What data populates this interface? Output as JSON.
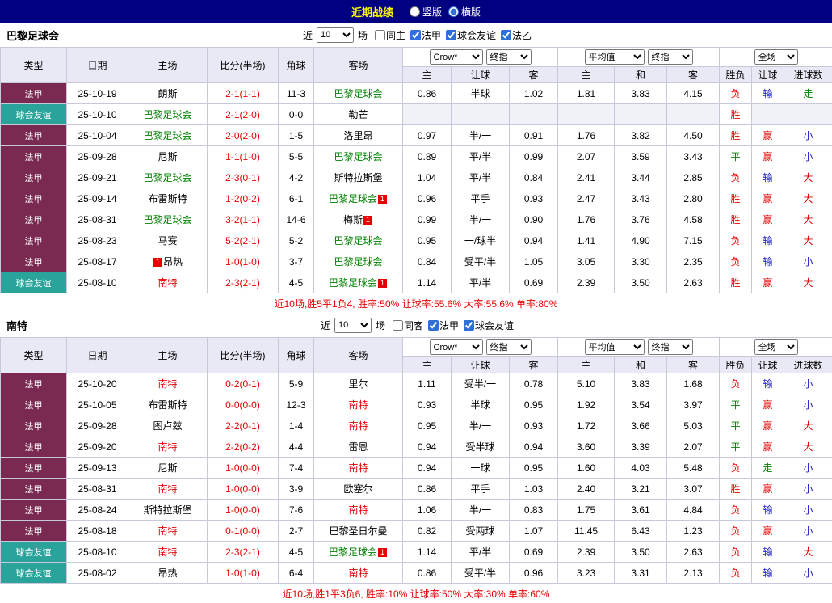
{
  "topbar": {
    "title": "近期战绩",
    "view_options": [
      {
        "label": "竖版",
        "selected": false
      },
      {
        "label": "横版",
        "selected": true
      }
    ]
  },
  "colors": {
    "topbar_bg": "#000080",
    "topbar_title": "#FFFF00",
    "ligue1_bg": "#7A2950",
    "friendly_bg": "#2AA39B",
    "header_bg": "#E9E9F5",
    "grid_border": "#C8C8DC",
    "score_text": "#E60000",
    "win_text": "#E60000",
    "draw_text": "#008000",
    "lose_text": "#2222CC",
    "team_paris": "#008000",
    "team_nantes": "#E60000"
  },
  "table_headers": {
    "left": [
      "类型",
      "日期",
      "主场",
      "比分(半场)",
      "角球",
      "客场"
    ],
    "odds": [
      "主",
      "让球",
      "客"
    ],
    "avg": [
      "主",
      "和",
      "客"
    ],
    "result": [
      "胜负",
      "让球",
      "进球数"
    ]
  },
  "selects": {
    "bookmaker": "Crow*",
    "stage": "终指",
    "average": "平均值",
    "stage2": "终指",
    "scope": "全场"
  },
  "tables": [
    {
      "team": "巴黎足球会",
      "filter": {
        "near_label": "近",
        "count": "10",
        "unit_label": "场",
        "checkboxes": [
          {
            "label": "同主",
            "checked": false
          },
          {
            "label": "法甲",
            "checked": true
          },
          {
            "label": "球会友谊",
            "checked": true
          },
          {
            "label": "法乙",
            "checked": true
          }
        ]
      },
      "rows": [
        {
          "league": "法甲",
          "date": "25-10-19",
          "home": {
            "name": "朗斯"
          },
          "score": "2-1(1-1)",
          "corners": "11-3",
          "away": {
            "name": "巴黎足球会",
            "color": "green"
          },
          "odds": [
            "0.86",
            "半球",
            "1.02"
          ],
          "avg": [
            "1.81",
            "3.83",
            "4.15"
          ],
          "results": [
            [
              "负",
              "red"
            ],
            [
              "输",
              "blue"
            ],
            [
              "走",
              "green"
            ]
          ]
        },
        {
          "league": "球会友谊",
          "date": "25-10-10",
          "home": {
            "name": "巴黎足球会",
            "color": "green"
          },
          "score": "2-1(2-0)",
          "corners": "0-0",
          "away": {
            "name": "勒芒"
          },
          "odds": null,
          "avg": null,
          "results": [
            [
              "胜",
              "red"
            ],
            null,
            null
          ]
        },
        {
          "league": "法甲",
          "date": "25-10-04",
          "home": {
            "name": "巴黎足球会",
            "color": "green"
          },
          "score": "2-0(2-0)",
          "corners": "1-5",
          "away": {
            "name": "洛里昂"
          },
          "odds": [
            "0.97",
            "半/一",
            "0.91"
          ],
          "avg": [
            "1.76",
            "3.82",
            "4.50"
          ],
          "results": [
            [
              "胜",
              "red"
            ],
            [
              "赢",
              "red"
            ],
            [
              "小",
              "blue"
            ]
          ]
        },
        {
          "league": "法甲",
          "date": "25-09-28",
          "home": {
            "name": "尼斯"
          },
          "score": "1-1(1-0)",
          "corners": "5-5",
          "away": {
            "name": "巴黎足球会",
            "color": "green"
          },
          "odds": [
            "0.89",
            "平/半",
            "0.99"
          ],
          "avg": [
            "2.07",
            "3.59",
            "3.43"
          ],
          "results": [
            [
              "平",
              "green"
            ],
            [
              "赢",
              "red"
            ],
            [
              "小",
              "blue"
            ]
          ]
        },
        {
          "league": "法甲",
          "date": "25-09-21",
          "home": {
            "name": "巴黎足球会",
            "color": "green"
          },
          "score": "2-3(0-1)",
          "corners": "4-2",
          "away": {
            "name": "斯特拉斯堡"
          },
          "odds": [
            "1.04",
            "平/半",
            "0.84"
          ],
          "avg": [
            "2.41",
            "3.44",
            "2.85"
          ],
          "results": [
            [
              "负",
              "red"
            ],
            [
              "输",
              "blue"
            ],
            [
              "大",
              "red"
            ]
          ]
        },
        {
          "league": "法甲",
          "date": "25-09-14",
          "home": {
            "name": "布雷斯特"
          },
          "score": "1-2(0-2)",
          "corners": "6-1",
          "away": {
            "name": "巴黎足球会",
            "color": "green",
            "badge": "1",
            "badge_pos": "after"
          },
          "odds": [
            "0.96",
            "平手",
            "0.93"
          ],
          "avg": [
            "2.47",
            "3.43",
            "2.80"
          ],
          "results": [
            [
              "胜",
              "red"
            ],
            [
              "赢",
              "red"
            ],
            [
              "大",
              "red"
            ]
          ]
        },
        {
          "league": "法甲",
          "date": "25-08-31",
          "home": {
            "name": "巴黎足球会",
            "color": "green"
          },
          "score": "3-2(1-1)",
          "corners": "14-6",
          "away": {
            "name": "梅斯",
            "badge": "1",
            "badge_pos": "after"
          },
          "odds": [
            "0.99",
            "半/一",
            "0.90"
          ],
          "avg": [
            "1.76",
            "3.76",
            "4.58"
          ],
          "results": [
            [
              "胜",
              "red"
            ],
            [
              "赢",
              "red"
            ],
            [
              "大",
              "red"
            ]
          ]
        },
        {
          "league": "法甲",
          "date": "25-08-23",
          "home": {
            "name": "马赛"
          },
          "score": "5-2(2-1)",
          "corners": "5-2",
          "away": {
            "name": "巴黎足球会",
            "color": "green"
          },
          "odds": [
            "0.95",
            "一/球半",
            "0.94"
          ],
          "avg": [
            "1.41",
            "4.90",
            "7.15"
          ],
          "results": [
            [
              "负",
              "red"
            ],
            [
              "输",
              "blue"
            ],
            [
              "大",
              "red"
            ]
          ]
        },
        {
          "league": "法甲",
          "date": "25-08-17",
          "home": {
            "name": "昂热",
            "badge": "1",
            "badge_pos": "before"
          },
          "score": "1-0(1-0)",
          "corners": "3-7",
          "away": {
            "name": "巴黎足球会",
            "color": "green"
          },
          "odds": [
            "0.84",
            "受平/半",
            "1.05"
          ],
          "avg": [
            "3.05",
            "3.30",
            "2.35"
          ],
          "results": [
            [
              "负",
              "red"
            ],
            [
              "输",
              "blue"
            ],
            [
              "小",
              "blue"
            ]
          ]
        },
        {
          "league": "球会友谊",
          "date": "25-08-10",
          "home": {
            "name": "南特",
            "color": "red"
          },
          "score": "2-3(2-1)",
          "corners": "4-5",
          "away": {
            "name": "巴黎足球会",
            "color": "green",
            "badge": "1",
            "badge_pos": "after"
          },
          "odds": [
            "1.14",
            "平/半",
            "0.69"
          ],
          "avg": [
            "2.39",
            "3.50",
            "2.63"
          ],
          "results": [
            [
              "胜",
              "red"
            ],
            [
              "赢",
              "red"
            ],
            [
              "大",
              "red"
            ]
          ]
        }
      ],
      "summary": "近10场,胜5平1负4, 胜率:50% 让球率:55.6% 大率:55.6% 单率:80%"
    },
    {
      "team": "南特",
      "filter": {
        "near_label": "近",
        "count": "10",
        "unit_label": "场",
        "checkboxes": [
          {
            "label": "同客",
            "checked": false
          },
          {
            "label": "法甲",
            "checked": true
          },
          {
            "label": "球会友谊",
            "checked": true
          }
        ]
      },
      "rows": [
        {
          "league": "法甲",
          "date": "25-10-20",
          "home": {
            "name": "南特",
            "color": "red"
          },
          "score": "0-2(0-1)",
          "corners": "5-9",
          "away": {
            "name": "里尔"
          },
          "odds": [
            "1.11",
            "受半/一",
            "0.78"
          ],
          "avg": [
            "5.10",
            "3.83",
            "1.68"
          ],
          "results": [
            [
              "负",
              "red"
            ],
            [
              "输",
              "blue"
            ],
            [
              "小",
              "blue"
            ]
          ]
        },
        {
          "league": "法甲",
          "date": "25-10-05",
          "home": {
            "name": "布雷斯特"
          },
          "score": "0-0(0-0)",
          "corners": "12-3",
          "away": {
            "name": "南特",
            "color": "red"
          },
          "odds": [
            "0.93",
            "半球",
            "0.95"
          ],
          "avg": [
            "1.92",
            "3.54",
            "3.97"
          ],
          "results": [
            [
              "平",
              "green"
            ],
            [
              "赢",
              "red"
            ],
            [
              "小",
              "blue"
            ]
          ]
        },
        {
          "league": "法甲",
          "date": "25-09-28",
          "home": {
            "name": "图卢兹"
          },
          "score": "2-2(0-1)",
          "corners": "1-4",
          "away": {
            "name": "南特",
            "color": "red"
          },
          "odds": [
            "0.95",
            "半/一",
            "0.93"
          ],
          "avg": [
            "1.72",
            "3.66",
            "5.03"
          ],
          "results": [
            [
              "平",
              "green"
            ],
            [
              "赢",
              "red"
            ],
            [
              "大",
              "red"
            ]
          ]
        },
        {
          "league": "法甲",
          "date": "25-09-20",
          "home": {
            "name": "南特",
            "color": "red"
          },
          "score": "2-2(0-2)",
          "corners": "4-4",
          "away": {
            "name": "雷恩"
          },
          "odds": [
            "0.94",
            "受半球",
            "0.94"
          ],
          "avg": [
            "3.60",
            "3.39",
            "2.07"
          ],
          "results": [
            [
              "平",
              "green"
            ],
            [
              "赢",
              "red"
            ],
            [
              "大",
              "red"
            ]
          ]
        },
        {
          "league": "法甲",
          "date": "25-09-13",
          "home": {
            "name": "尼斯"
          },
          "score": "1-0(0-0)",
          "corners": "7-4",
          "away": {
            "name": "南特",
            "color": "red"
          },
          "odds": [
            "0.94",
            "一球",
            "0.95"
          ],
          "avg": [
            "1.60",
            "4.03",
            "5.48"
          ],
          "results": [
            [
              "负",
              "red"
            ],
            [
              "走",
              "green"
            ],
            [
              "小",
              "blue"
            ]
          ]
        },
        {
          "league": "法甲",
          "date": "25-08-31",
          "home": {
            "name": "南特",
            "color": "red"
          },
          "score": "1-0(0-0)",
          "corners": "3-9",
          "away": {
            "name": "欧塞尔"
          },
          "odds": [
            "0.86",
            "平手",
            "1.03"
          ],
          "avg": [
            "2.40",
            "3.21",
            "3.07"
          ],
          "results": [
            [
              "胜",
              "red"
            ],
            [
              "赢",
              "red"
            ],
            [
              "小",
              "blue"
            ]
          ]
        },
        {
          "league": "法甲",
          "date": "25-08-24",
          "home": {
            "name": "斯特拉斯堡"
          },
          "score": "1-0(0-0)",
          "corners": "7-6",
          "away": {
            "name": "南特",
            "color": "red"
          },
          "odds": [
            "1.06",
            "半/一",
            "0.83"
          ],
          "avg": [
            "1.75",
            "3.61",
            "4.84"
          ],
          "results": [
            [
              "负",
              "red"
            ],
            [
              "输",
              "blue"
            ],
            [
              "小",
              "blue"
            ]
          ]
        },
        {
          "league": "法甲",
          "date": "25-08-18",
          "home": {
            "name": "南特",
            "color": "red"
          },
          "score": "0-1(0-0)",
          "corners": "2-7",
          "away": {
            "name": "巴黎圣日尔曼"
          },
          "odds": [
            "0.82",
            "受两球",
            "1.07"
          ],
          "avg": [
            "11.45",
            "6.43",
            "1.23"
          ],
          "results": [
            [
              "负",
              "red"
            ],
            [
              "赢",
              "red"
            ],
            [
              "小",
              "blue"
            ]
          ]
        },
        {
          "league": "球会友谊",
          "date": "25-08-10",
          "home": {
            "name": "南特",
            "color": "red"
          },
          "score": "2-3(2-1)",
          "corners": "4-5",
          "away": {
            "name": "巴黎足球会",
            "color": "green",
            "badge": "1",
            "badge_pos": "after"
          },
          "odds": [
            "1.14",
            "平/半",
            "0.69"
          ],
          "avg": [
            "2.39",
            "3.50",
            "2.63"
          ],
          "results": [
            [
              "负",
              "red"
            ],
            [
              "输",
              "blue"
            ],
            [
              "大",
              "red"
            ]
          ]
        },
        {
          "league": "球会友谊",
          "date": "25-08-02",
          "home": {
            "name": "昂热"
          },
          "score": "1-0(1-0)",
          "corners": "6-4",
          "away": {
            "name": "南特",
            "color": "red"
          },
          "odds": [
            "0.86",
            "受平/半",
            "0.96"
          ],
          "avg": [
            "3.23",
            "3.31",
            "2.13"
          ],
          "results": [
            [
              "负",
              "red"
            ],
            [
              "输",
              "blue"
            ],
            [
              "小",
              "blue"
            ]
          ]
        }
      ],
      "summary": "近10场,胜1平3负6, 胜率:10% 让球率:50% 大率:30% 单率:60%"
    }
  ]
}
